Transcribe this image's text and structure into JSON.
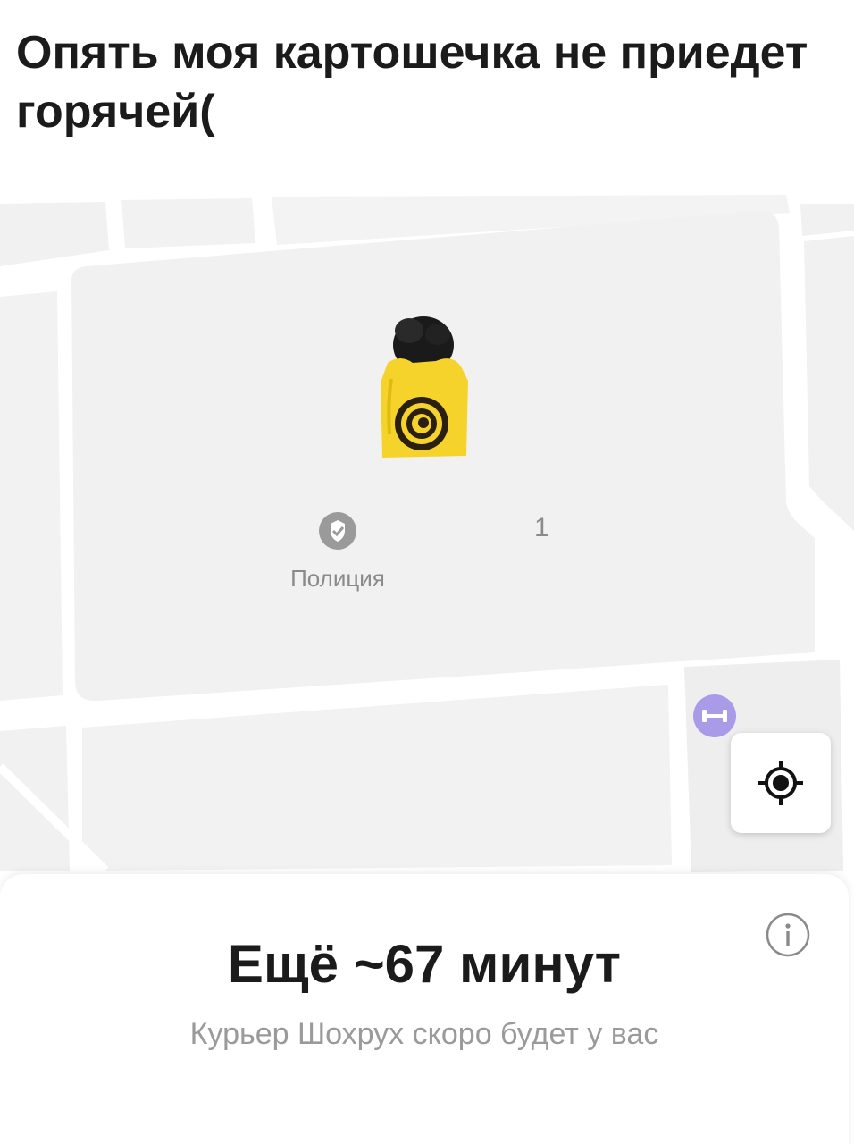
{
  "caption": "Опять моя картошечка не приедет горячей(",
  "map": {
    "poi_police": {
      "label": "Полиция",
      "icon": "police-badge-icon"
    },
    "house_number": "1",
    "gym_icon": "dumbbell-icon",
    "courier_icon": "courier-marker-icon",
    "locate_icon": "locate-me-icon",
    "colors": {
      "block_fill": "#f1f1f1",
      "road": "#ffffff",
      "accent_yellow": "#f5d32a",
      "gym_purple": "#a99be8"
    }
  },
  "sheet": {
    "eta": "Ещё ~67 минут",
    "status": "Курьер Шохрух скоро будет у вас",
    "info_icon": "info-icon"
  }
}
